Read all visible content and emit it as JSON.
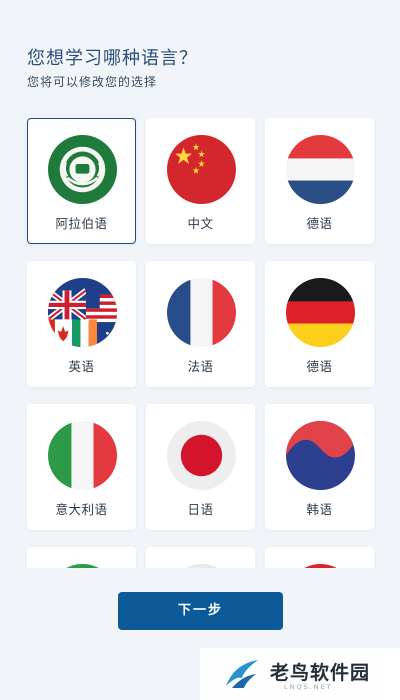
{
  "header": {
    "title": "您想学习哪种语言？",
    "subtitle": "您将可以修改您的选择"
  },
  "languages": [
    {
      "label": "阿拉伯语",
      "flag_icon": "arabic-league-flag-icon",
      "selected": true
    },
    {
      "label": "中文",
      "flag_icon": "china-flag-icon",
      "selected": false
    },
    {
      "label": "德语",
      "flag_icon": "netherlands-flag-icon",
      "selected": false
    },
    {
      "label": "英语",
      "flag_icon": "english-flags-icon",
      "selected": false
    },
    {
      "label": "法语",
      "flag_icon": "france-flag-icon",
      "selected": false
    },
    {
      "label": "德语",
      "flag_icon": "germany-flag-icon",
      "selected": false
    },
    {
      "label": "意大利语",
      "flag_icon": "italy-flag-icon",
      "selected": false
    },
    {
      "label": "日语",
      "flag_icon": "japan-flag-icon",
      "selected": false
    },
    {
      "label": "韩语",
      "flag_icon": "korea-flag-icon",
      "selected": false
    }
  ],
  "footer": {
    "next_label": "下一步"
  },
  "watermark": {
    "name": "老鸟软件园",
    "site": "LNQS.NET"
  },
  "colors": {
    "accent": "#0d5a99",
    "selected_border": "#1e4e84",
    "background": "#f1f5f9"
  }
}
